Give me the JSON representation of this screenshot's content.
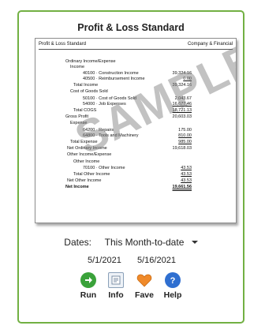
{
  "card": {
    "title": "Profit & Loss Standard",
    "report": {
      "header_left": "Profit & Loss Standard",
      "header_right": "Company & Financial",
      "watermark": "SAMPLE",
      "rows": [
        {
          "label": "Ordinary Income/Expense",
          "amount": ""
        },
        {
          "label": "Income",
          "amount": ""
        },
        {
          "label": "40100 · Construction Income",
          "amount": "39,324.16"
        },
        {
          "label": "40500 · Reimbursement Income",
          "amount": "0.00"
        },
        {
          "label": "Total Income",
          "amount": "39,324.16"
        },
        {
          "label": "Cost of Goods Sold",
          "amount": ""
        },
        {
          "label": "50100 · Cost of Goods Sold",
          "amount": "2,043.67"
        },
        {
          "label": "54000 · Job Expenses",
          "amount": "16,677.46"
        },
        {
          "label": "Total COGS",
          "amount": "18,721.13"
        },
        {
          "label": "Gross Profit",
          "amount": "20,603.03"
        },
        {
          "label": "Expense",
          "amount": ""
        },
        {
          "label": "64200 · Repairs",
          "amount": "175.00"
        },
        {
          "label": "64800 · Tools and Machinery",
          "amount": "810.00"
        },
        {
          "label": "Total Expense",
          "amount": "985.00"
        },
        {
          "label": "Net Ordinary Income",
          "amount": "19,618.03"
        },
        {
          "label": "Other Income/Expense",
          "amount": ""
        },
        {
          "label": "Other Income",
          "amount": ""
        },
        {
          "label": "70100 · Other Income",
          "amount": "43.53"
        },
        {
          "label": "Total Other Income",
          "amount": "43.53"
        },
        {
          "label": "Net Other Income",
          "amount": "43.53"
        },
        {
          "label": "Net Income",
          "amount": "19,661.56"
        }
      ]
    },
    "dates": {
      "label": "Dates:",
      "selected": "This Month-to-date",
      "from": "5/1/2021",
      "to": "5/16/2021"
    },
    "actions": {
      "run": "Run",
      "info": "Info",
      "fave": "Fave",
      "help": "Help"
    },
    "colors": {
      "border": "#72b043",
      "run": "#3aa23a",
      "fave": "#f08a2a",
      "help": "#2f6fd0"
    }
  }
}
